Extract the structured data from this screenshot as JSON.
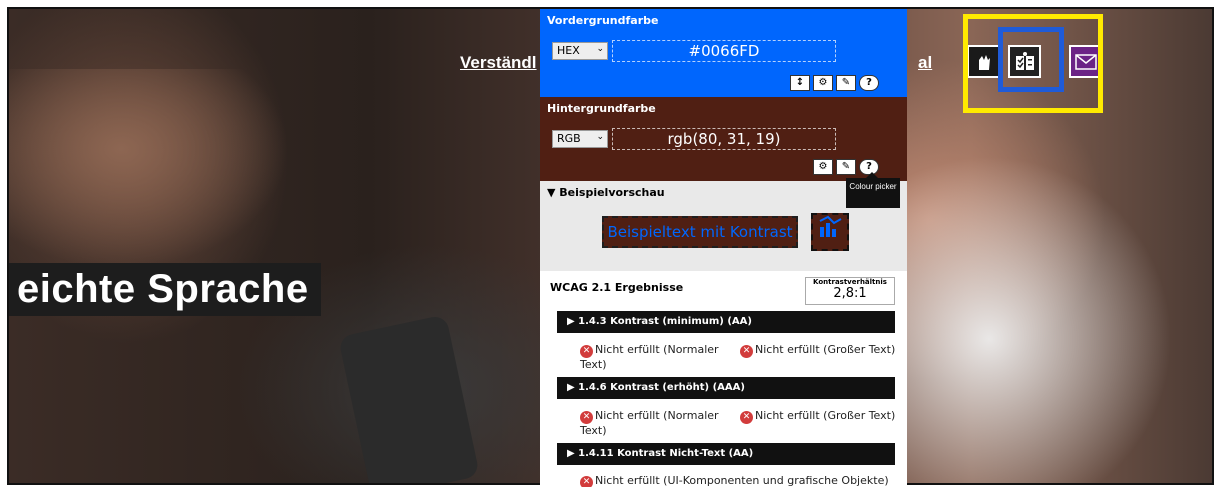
{
  "nav": {
    "link_left": "Verständl",
    "link_right": "al"
  },
  "hero": {
    "title": "eichte Sprache"
  },
  "toolbar_icons": [
    "sign-language-icon",
    "easy-language-icon",
    "mail-icon"
  ],
  "foreground": {
    "title": "Vordergrundfarbe",
    "format": "HEX",
    "value": "#0066FD",
    "color": "#0066FD",
    "tools": [
      "↕",
      "⚙",
      "✎",
      "?"
    ]
  },
  "background": {
    "title": "Hintergrundfarbe",
    "format": "RGB",
    "value": "rgb(80, 31, 19)",
    "color": "#501F13",
    "tools": [
      "⚙",
      "✎",
      "?"
    ]
  },
  "tooltip": "Colour picker",
  "preview": {
    "title": "▼ Beispielvorschau",
    "sample_text": "Beispieltext mit Kontrast"
  },
  "results": {
    "title": "WCAG 2.1 Ergebnisse",
    "ratio_label": "Kontrastverhältnis",
    "ratio_value": "2,8:1",
    "criteria": [
      {
        "label": "▶  1.4.3 Kontrast (minimum) (AA)",
        "normal": "Nicht erfüllt (Normaler Text)",
        "large": "Nicht erfüllt (Großer Text)"
      },
      {
        "label": "▶  1.4.6 Kontrast (erhöht) (AAA)",
        "normal": "Nicht erfüllt (Normaler Text)",
        "large": "Nicht erfüllt (Großer Text)"
      },
      {
        "label": "▶  1.4.11 Kontrast Nicht-Text (AA)",
        "ui": "Nicht erfüllt (UI-Komponenten und grafische Objekte)"
      }
    ]
  },
  "colors": {
    "highlight_yellow": "#FFEA00",
    "highlight_blue": "#1F5BD8",
    "mail_purple": "#6B2386"
  }
}
